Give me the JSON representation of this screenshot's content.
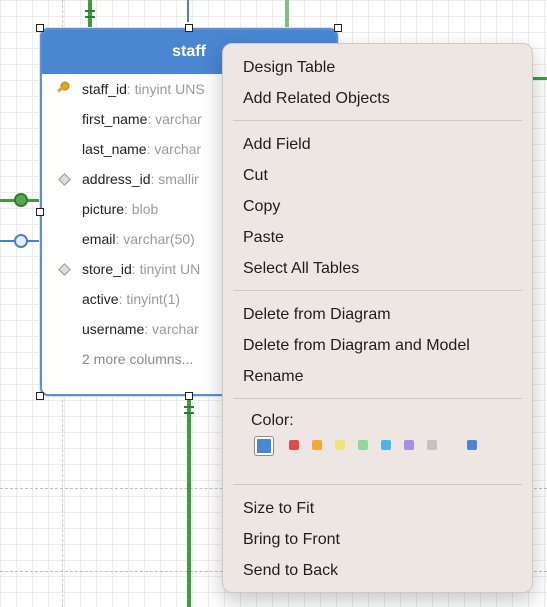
{
  "table": {
    "title": "staff",
    "columns": [
      {
        "name": "staff_id",
        "type": ": tinyint UNS",
        "icon": "key-icon"
      },
      {
        "name": "first_name",
        "type": ": varchar",
        "icon": ""
      },
      {
        "name": "last_name",
        "type": ": varchar",
        "icon": ""
      },
      {
        "name": "address_id",
        "type": ": smallir",
        "icon": "foreign-key-icon"
      },
      {
        "name": "picture",
        "type": ": blob",
        "icon": ""
      },
      {
        "name": "email",
        "type": ": varchar(50)",
        "icon": ""
      },
      {
        "name": "store_id",
        "type": ": tinyint UN",
        "icon": "foreign-key-icon"
      },
      {
        "name": "active",
        "type": ": tinyint(1)",
        "icon": ""
      },
      {
        "name": "username",
        "type": ": varchar",
        "icon": ""
      }
    ],
    "more_columns": "2 more columns...",
    "header_color": "#4a86d2"
  },
  "menu": {
    "group1": [
      "Design Table",
      "Add Related Objects"
    ],
    "group2": [
      "Add Field",
      "Cut",
      "Copy",
      "Paste",
      "Select All Tables"
    ],
    "group3": [
      "Delete from Diagram",
      "Delete from Diagram and Model",
      "Rename"
    ],
    "color_label": "Color:",
    "colors": [
      "#4a86d2",
      "#e44a4a",
      "#f2a93b",
      "#f1e27a",
      "#8fd7a0",
      "#4fb3ea",
      "#a98be8",
      "#c3c3c3",
      "#4a86d2"
    ],
    "selected_color_index": 0,
    "group4": [
      "Size to Fit",
      "Bring to Front",
      "Send to Back"
    ]
  }
}
